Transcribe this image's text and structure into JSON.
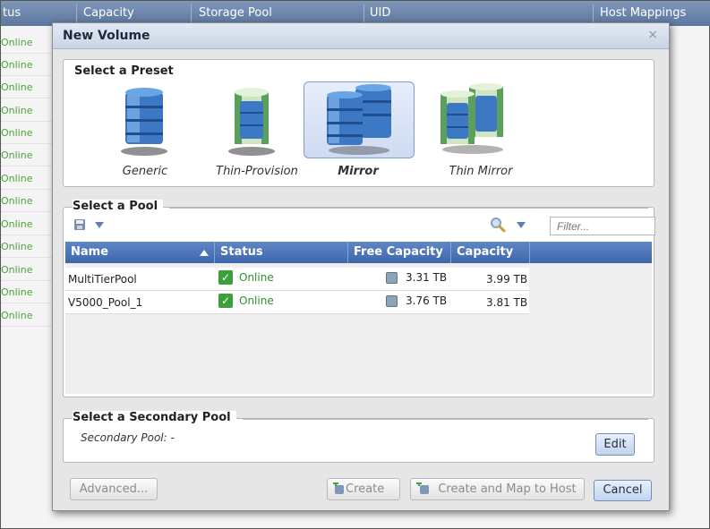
{
  "background": {
    "columns": [
      "tus",
      "Capacity",
      "Storage Pool",
      "UID",
      "Host Mappings"
    ],
    "row_status": [
      "Online",
      "Online",
      "Online",
      "Online",
      "Online",
      "Online",
      "Online",
      "Online",
      "Online",
      "Online",
      "Online",
      "Online",
      "Online"
    ]
  },
  "dialog": {
    "title": "New Volume",
    "close_glyph": "×",
    "presets": {
      "heading": "Select a Preset",
      "items": [
        {
          "label": "Generic",
          "selected": false
        },
        {
          "label": "Thin-Provision",
          "selected": false
        },
        {
          "label": "Mirror",
          "selected": true
        },
        {
          "label": "Thin Mirror",
          "selected": false
        }
      ]
    },
    "pool": {
      "heading": "Select a Pool",
      "filter_placeholder": "Filter...",
      "columns": [
        "Name",
        "Status",
        "Free Capacity",
        "Capacity"
      ],
      "rows": [
        {
          "name": "MultiTierPool",
          "status": "Online",
          "free": "3.31 TB",
          "capacity": "3.99 TB"
        },
        {
          "name": "V5000_Pool_1",
          "status": "Online",
          "free": "3.76 TB",
          "capacity": "3.81 TB"
        }
      ]
    },
    "secondary": {
      "heading": "Select a Secondary Pool",
      "label": "Secondary Pool: -",
      "edit_label": "Edit"
    },
    "buttons": {
      "advanced": "Advanced...",
      "create": "Create",
      "create_map": "Create and Map to Host",
      "cancel": "Cancel"
    }
  },
  "colors": {
    "header": "#5c779f",
    "grid_header": "#4a72b6",
    "online": "#2f8f2f"
  }
}
